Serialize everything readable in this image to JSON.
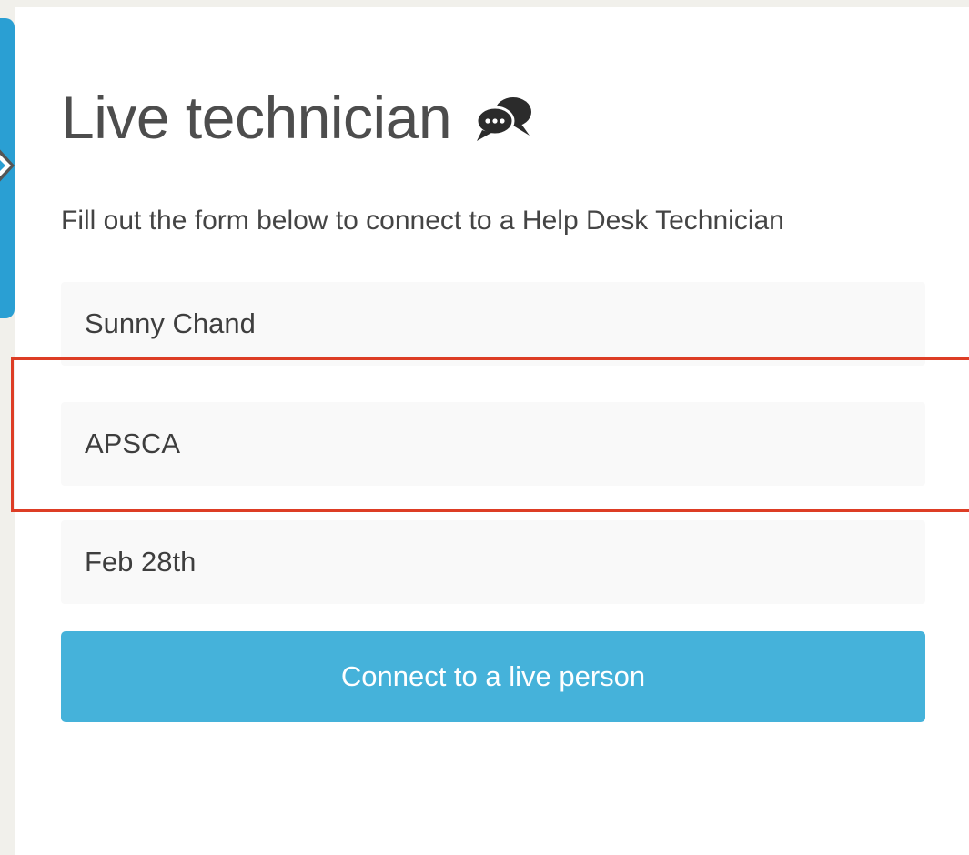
{
  "header": {
    "title": "Live technician",
    "title_icon": "chat-bubbles-icon"
  },
  "form": {
    "description": "Fill out the form below to connect to a Help Desk Technician",
    "fields": [
      {
        "value": "Sunny Chand"
      },
      {
        "value": "APSCA"
      },
      {
        "value": "Feb 28th"
      }
    ],
    "submit_label": "Connect to a live person"
  },
  "colors": {
    "side_panel": "#2a9fd3",
    "button": "#45b2da",
    "highlight_border": "#dd3d25",
    "field_background": "#f9f9f9"
  }
}
